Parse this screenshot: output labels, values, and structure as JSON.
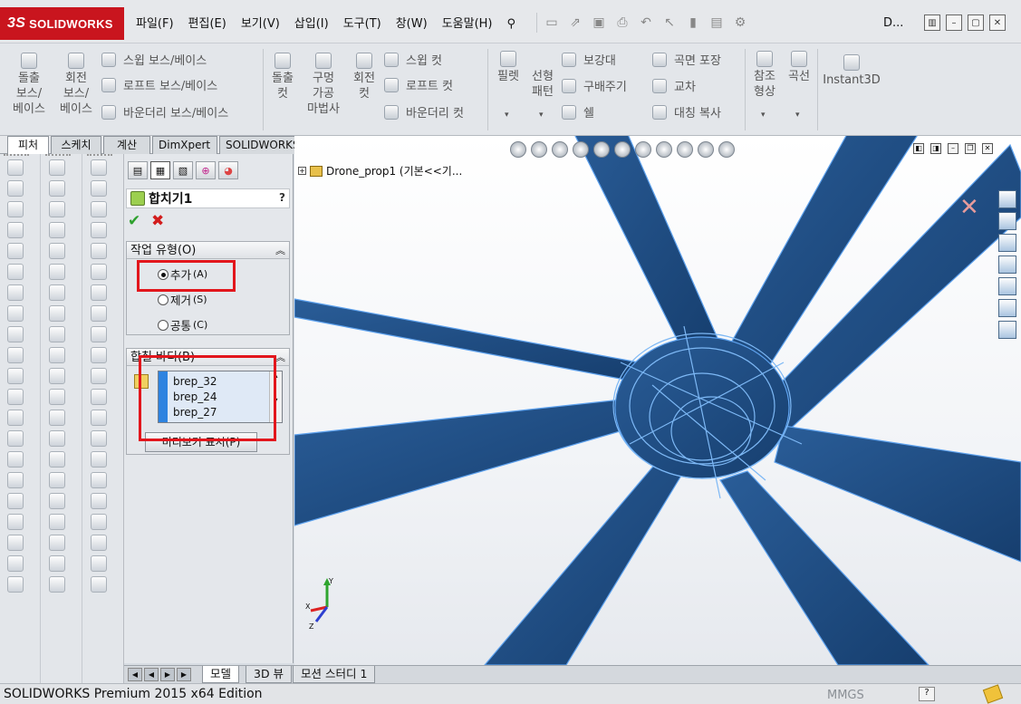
{
  "app": {
    "logo_text": "SOLIDWORKS",
    "window_title": "D...",
    "status_text": "SOLIDWORKS Premium 2015 x64 Edition",
    "units": "MMGS"
  },
  "menu": [
    "파일(F)",
    "편집(E)",
    "보기(V)",
    "삽입(I)",
    "도구(T)",
    "창(W)",
    "도움말(H)"
  ],
  "command_manager": {
    "extrude_boss_line1": "돌출",
    "extrude_boss_line2": "보스/",
    "extrude_boss_line3": "베이스",
    "revolve_boss_line1": "회전",
    "revolve_boss_line2": "보스/",
    "revolve_boss_line3": "베이스",
    "swept_boss": "스윕 보스/베이스",
    "loft_boss": "로프트 보스/베이스",
    "boundary_boss": "바운더리 보스/베이스",
    "extrude_cut_line1": "돌출",
    "extrude_cut_line2": "컷",
    "hole_wizard_line1": "구멍",
    "hole_wizard_line2": "가공",
    "hole_wizard_line3": "마법사",
    "revolve_cut_line1": "회전",
    "revolve_cut_line2": "컷",
    "swept_cut": "스윕 컷",
    "loft_cut": "로프트 컷",
    "boundary_cut": "바운더리 컷",
    "fillet": "필렛",
    "linear_pattern_line1": "선형",
    "linear_pattern_line2": "패턴",
    "rib": "보강대",
    "draft": "구배주기",
    "shell": "쉘",
    "wrap": "곡면 포장",
    "intersect": "교차",
    "mirror": "대칭 복사",
    "ref_geom_line1": "참조",
    "ref_geom_line2": "형상",
    "curves": "곡선",
    "instant3d": "Instant3D"
  },
  "cm_tabs": [
    "피처",
    "스케치",
    "계산",
    "DimXpert",
    "SOLIDWORKS 애드인"
  ],
  "property_manager": {
    "title": "합치기1",
    "help": "?",
    "ok_symbol": "✔",
    "cancel_symbol": "✖",
    "operation_group": {
      "label": "작업 유형(O)",
      "options": [
        {
          "label": "추가",
          "shortcut": "(A)",
          "selected": true
        },
        {
          "label": "제거",
          "shortcut": "(S)",
          "selected": false
        },
        {
          "label": "공통",
          "shortcut": "(C)",
          "selected": false
        }
      ]
    },
    "bodies_group": {
      "label": "합칠 바디(B)",
      "items": [
        "brep_32",
        "brep_24",
        "brep_27"
      ],
      "preview_button": "미리보기 표시(P)"
    }
  },
  "viewport": {
    "tree_node": "Drone_prop1  (기본<<기...",
    "colors": {
      "model": "#1f4e86",
      "model_edge": "#5ea2ee",
      "highlight": "#e2161c"
    }
  },
  "bottom_tabs": [
    "모델",
    "3D 뷰",
    "모션 스터디 1"
  ]
}
